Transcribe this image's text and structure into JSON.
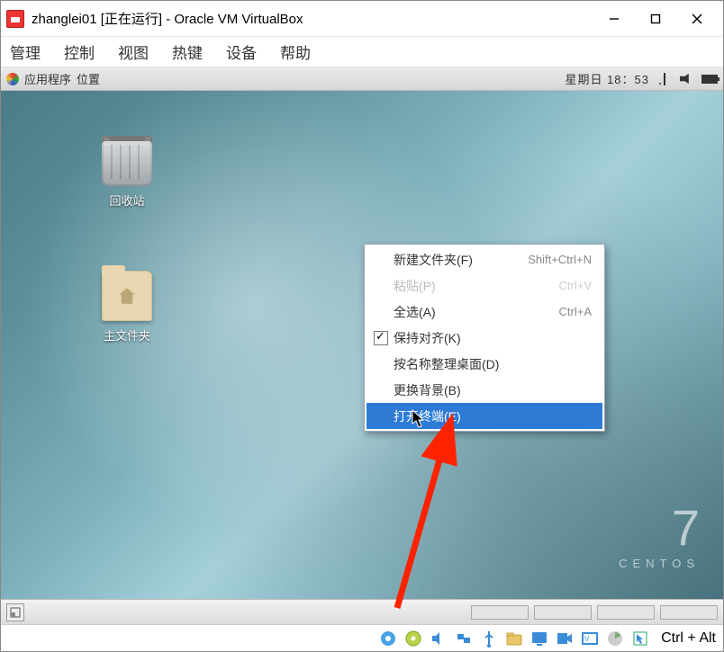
{
  "windowTitle": "zhanglei01 [正在运行] - Oracle VM VirtualBox",
  "vbMenu": {
    "manage": "管理",
    "control": "控制",
    "view": "视图",
    "hotkey": "热键",
    "device": "设备",
    "help": "帮助"
  },
  "guestPanel": {
    "apps": "应用程序",
    "places": "位置",
    "clock": "星期日 18：53"
  },
  "desktopIcons": {
    "trash": "回收站",
    "home": "主文件夹"
  },
  "centos": {
    "num": "7",
    "txt": "CENTOS"
  },
  "contextMenu": {
    "newFolder": {
      "label": "新建文件夹(F)",
      "shortcut": "Shift+Ctrl+N"
    },
    "paste": {
      "label": "粘贴(P)",
      "shortcut": "Ctrl+V"
    },
    "selectAll": {
      "label": "全选(A)",
      "shortcut": "Ctrl+A"
    },
    "keepAligned": {
      "label": "保持对齐(K)"
    },
    "organize": {
      "label": "按名称整理桌面(D)"
    },
    "changeBg": {
      "label": "更换背景(B)"
    },
    "openTerminal": {
      "label": "打开终端(E)"
    }
  },
  "hostKey": "Ctrl + Alt"
}
